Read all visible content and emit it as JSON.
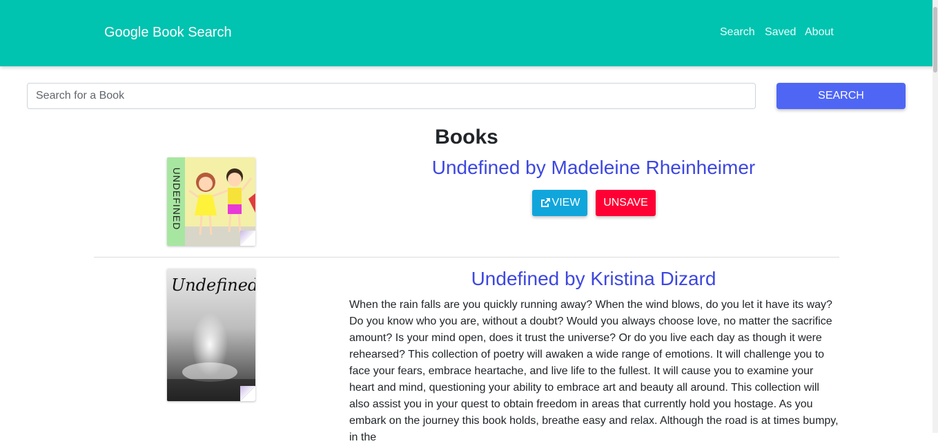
{
  "navbar": {
    "brand": "Google Book Search",
    "links": [
      "Search",
      "Saved",
      "About"
    ],
    "background": "#00c3b0"
  },
  "search": {
    "placeholder": "Search for a Book",
    "value": "",
    "button_label": "SEARCH"
  },
  "results": {
    "heading": "Books",
    "books": [
      {
        "title": "Undefined by Madeleine Rheinheimer",
        "cover_text": "UNDEFINED",
        "view_label": "VIEW",
        "unsave_label": "UNSAVE",
        "description": ""
      },
      {
        "title": "Undefined by Kristina Dizard",
        "cover_text": "Undefined",
        "description": "When the rain falls are you quickly running away? When the wind blows, do you let it have its way? Do you know who you are, without a doubt? Would you always choose love, no matter the sacrifice amount? Is your mind open, does it trust the universe? Or do you live each day as though it were rehearsed? This collection of poetry will awaken a wide range of emotions. It will challenge you to face your fears, embrace heartache, and live life to the fullest. It will cause you to examine your heart and mind, questioning your ability to embrace art and beauty all around. This collection will also assist you in your quest to obtain freedom in areas that currently hold you hostage. As you embark on the journey this book holds, breathe easy and relax. Although the road is at times bumpy, in the"
      }
    ]
  },
  "colors": {
    "accent": "#00c3b0",
    "search_button": "#4f66f5",
    "view_button": "#10a6dc",
    "unsave_button": "#ff0035",
    "title_link": "#3d47e0"
  }
}
